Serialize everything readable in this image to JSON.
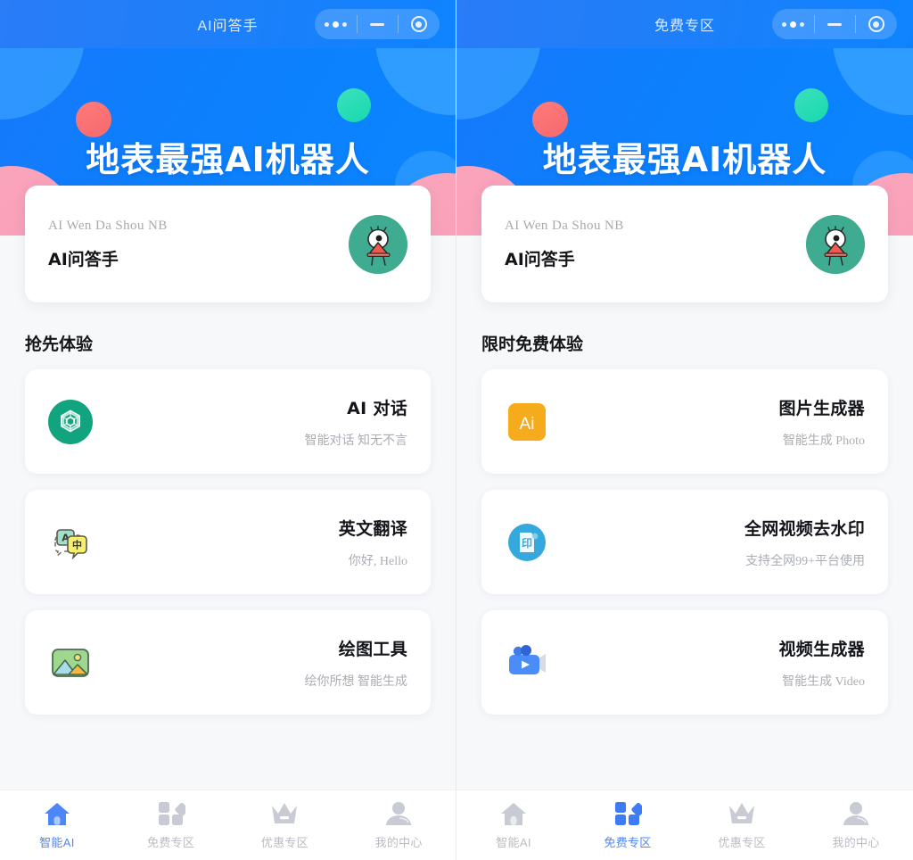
{
  "panels": [
    {
      "titlebar": {
        "title": "AI问答手",
        "controls": [
          "more-dots",
          "minimize",
          "close-target"
        ]
      },
      "hero": {
        "title": "地表最强AI机器人"
      },
      "profile": {
        "subtitle": "AI Wen Da Shou NB",
        "name": "AI问答手",
        "avatar": "monster-avatar"
      },
      "section": {
        "title": "抢先体验"
      },
      "items": [
        {
          "icon": "openai-logo-icon",
          "title": "AI 对话",
          "desc": "智能对话 知无不言"
        },
        {
          "icon": "translate-icon",
          "title": "英文翻译",
          "desc": "你好, Hello"
        },
        {
          "icon": "picture-icon",
          "title": "绘图工具",
          "desc": "绘你所想 智能生成"
        }
      ],
      "tabs": [
        {
          "icon": "home-icon",
          "label": "智能AI",
          "active": true
        },
        {
          "icon": "grid-icon",
          "label": "免费专区",
          "active": false
        },
        {
          "icon": "crown-icon",
          "label": "优惠专区",
          "active": false
        },
        {
          "icon": "person-icon",
          "label": "我的中心",
          "active": false
        }
      ]
    },
    {
      "titlebar": {
        "title": "免费专区",
        "controls": [
          "more-dots",
          "minimize",
          "close-target"
        ]
      },
      "hero": {
        "title": "地表最强AI机器人"
      },
      "profile": {
        "subtitle": "AI Wen Da Shou NB",
        "name": "AI问答手",
        "avatar": "monster-avatar"
      },
      "section": {
        "title": "限时免费体验"
      },
      "items": [
        {
          "icon": "ai-badge-icon",
          "title": "图片生成器",
          "desc": "智能生成 Photo"
        },
        {
          "icon": "watermark-icon",
          "title": "全网视频去水印",
          "desc": "支持全网99+平台使用"
        },
        {
          "icon": "video-camera-icon",
          "title": "视频生成器",
          "desc": "智能生成 Video"
        }
      ],
      "tabs": [
        {
          "icon": "home-icon",
          "label": "智能AI",
          "active": false
        },
        {
          "icon": "grid-icon",
          "label": "免费专区",
          "active": true
        },
        {
          "icon": "crown-icon",
          "label": "优惠专区",
          "active": false
        },
        {
          "icon": "person-icon",
          "label": "我的中心",
          "active": false
        }
      ]
    }
  ],
  "colors": {
    "brand_blue": "#0d7ffd",
    "accent_blue": "#4d86f7",
    "inactive_gray": "#b9bcc4",
    "coral": "#f4696e",
    "teal": "#17d9b0",
    "pink": "#f79bb6",
    "avatar_green": "#3fac91",
    "orange": "#f5a623",
    "page_bg": "#f7f8fa"
  }
}
